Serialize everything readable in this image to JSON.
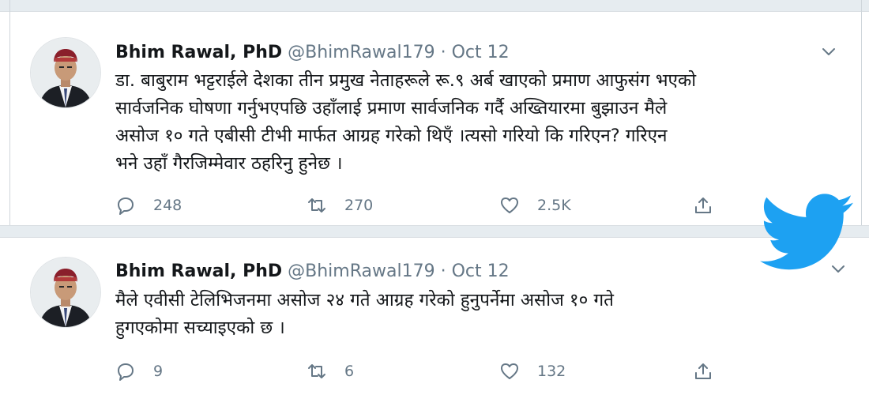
{
  "tweets": [
    {
      "name": "Bhim Rawal, PhD",
      "handle": "@BhimRawal179",
      "separator": "·",
      "date": "Oct 12",
      "lines": [
        "डा. बाबुराम भट्टराईले देशका तीन प्रमुख नेताहरूले रू.९ अर्ब खाएको प्रमाण आफुसंग भएको",
        "सार्वजनिक घोषणा गर्नुभएपछि उहाँलाई प्रमाण सार्वजनिक गर्दै अख्तियारमा बुझाउन मैले",
        "असोज १० गते एबीसी टीभी मार्फत आग्रह गरेको थिएँ ।त्यसो गरियो कि गरिएन? गरिएन",
        "भने उहाँ गैरजिम्मेवार ठहरिनु हुनेछ ।"
      ],
      "replies": "248",
      "retweets": "270",
      "likes": "2.5K"
    },
    {
      "name": "Bhim Rawal, PhD",
      "handle": "@BhimRawal179",
      "separator": "·",
      "date": "Oct 12",
      "lines": [
        "मैले एवीसी टेलिभिजनमा असोज २४ गते आग्रह गरेको हुनुपर्नेमा असोज १० गते",
        "हुगएकोमा सच्याइएको छ ।"
      ],
      "replies": "9",
      "retweets": "6",
      "likes": "132"
    }
  ],
  "icons": [
    "reply-icon",
    "retweet-icon",
    "like-icon",
    "share-icon",
    "chevron-down-icon",
    "twitter-bird-logo"
  ],
  "colors": {
    "text": "#14171a",
    "secondary": "#657786",
    "separator": "#e6ecf0",
    "twitter_blue": "#1da1f2"
  }
}
